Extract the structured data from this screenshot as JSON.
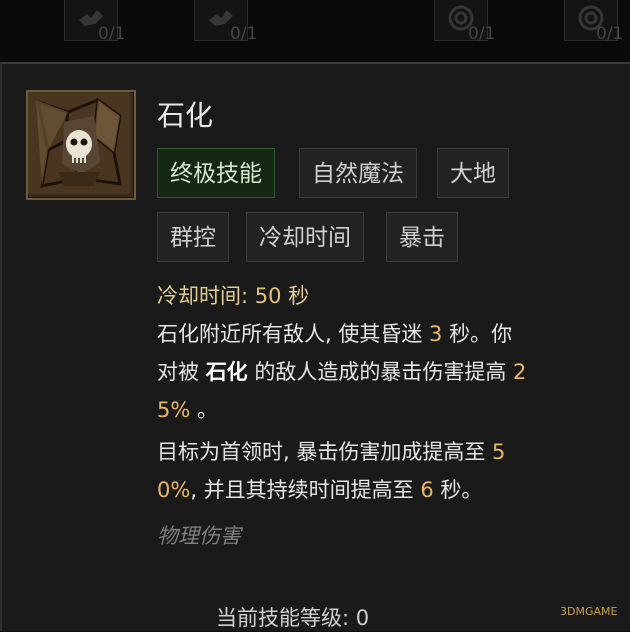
{
  "top_slots": [
    {
      "count": "0/1",
      "icon": "bird-icon"
    },
    {
      "count": "0/1",
      "icon": "bird-icon"
    },
    {
      "count": "0/1",
      "icon": "swirl-icon"
    },
    {
      "count": "0/1",
      "icon": "swirl-icon"
    }
  ],
  "skill": {
    "name": "石化",
    "icon": "skull-stained-glass-icon",
    "tags_row1": [
      "终极技能",
      "自然魔法",
      "大地"
    ],
    "tags_row2": [
      "群控",
      "冷却时间",
      "暴击"
    ],
    "cooldown_label": "冷却时间:",
    "cooldown_value": "50",
    "cooldown_unit": "秒",
    "desc": {
      "l1_a": "石化附近所有敌人, 使其昏迷 ",
      "l1_num": "3",
      "l1_b": " 秒。你",
      "l2_a": "对被 ",
      "l2_kw": "石化",
      "l2_b": " 的敌人造成的暴击伤害提高 ",
      "l2_num": "2",
      "l3_num": "5%",
      "l3_b": " 。",
      "l4_a": "目标为首领时, 暴击伤害加成提高至 ",
      "l4_num": "5",
      "l5_num": "0%",
      "l5_a": ", 并且其持续时间提高至 ",
      "l5_num2": "6",
      "l5_b": " 秒。"
    },
    "damage_type": "物理伤害",
    "level_label": "当前技能等级:",
    "level_value": "0"
  },
  "watermark": "3DMGAME",
  "colors": {
    "highlight": "#e8b764",
    "ultimate_tag_bg": "#142814",
    "frame": "#6b5a3c"
  }
}
